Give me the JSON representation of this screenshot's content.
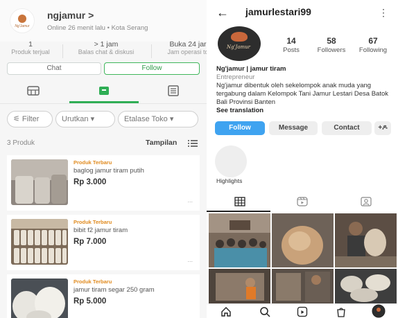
{
  "shop": {
    "name": "ngjamur >",
    "status": "Online 26 menit lalu • Kota Serang",
    "logo_text": "Ng'Jamur",
    "stats": [
      {
        "value": "1",
        "label": "Produk terjual"
      },
      {
        "value": "> 1 jam",
        "label": "Balas chat & diskusi"
      },
      {
        "value": "Buka 24 jar",
        "label": "Jam operasi to"
      }
    ],
    "chat_label": "Chat",
    "follow_label": "Follow",
    "filters": {
      "filter": "Filter",
      "sort": "Urutkan",
      "etalase": "Etalase Toko"
    },
    "product_count": "3 Produk",
    "view_label": "Tampilan",
    "products": [
      {
        "badge": "Produk Terbaru",
        "name": "baglog jamur tiram putih",
        "price": "Rp 3.000"
      },
      {
        "badge": "Produk Terbaru",
        "name": "bibit f2 jamur tiram",
        "price": "Rp 7.000"
      },
      {
        "badge": "Produk Terbaru",
        "name": "jamur tiram segar 250 gram",
        "price": "Rp 5.000"
      }
    ],
    "more_label": "...",
    "accent": "#2fae55"
  },
  "ig": {
    "back": "←",
    "username": "jamurlestari99",
    "menu": "⋮",
    "avatar_text": "Ng'Jamur",
    "stats": [
      {
        "value": "14",
        "label": "Posts"
      },
      {
        "value": "58",
        "label": "Followers"
      },
      {
        "value": "67",
        "label": "Following"
      }
    ],
    "bio_name": "Ng'jamur | jamur tiram",
    "bio_category": "Entrepreneur",
    "bio_text": "Ng'jamur dibentuk oleh sekelompok anak muda yang tergabung dalam Kelompok Tani Jamur Lestari Desa Batok Bali Provinsi Banten",
    "see_translation": "See translation",
    "buttons": {
      "follow": "Follow",
      "message": "Message",
      "contact": "Contact",
      "add": "+ዶ"
    },
    "highlights": "Highlights",
    "follow_color": "#3fa3f0"
  }
}
